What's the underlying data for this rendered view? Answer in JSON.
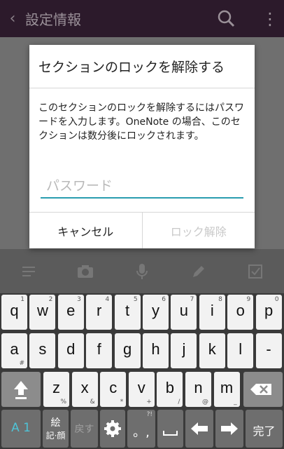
{
  "appbar": {
    "title": "設定情報"
  },
  "dialog": {
    "title": "セクションのロックを解除する",
    "message": "このセクションのロックを解除するにはパスワードを入力します。OneNote の場合、このセクションは数分後にロックされます。",
    "password_placeholder": "パスワード",
    "cancel_label": "キャンセル",
    "unlock_label": "ロック解除"
  },
  "keyboard": {
    "row1": [
      {
        "k": "q",
        "s": "1"
      },
      {
        "k": "w",
        "s": "2"
      },
      {
        "k": "e",
        "s": "3"
      },
      {
        "k": "r",
        "s": "4"
      },
      {
        "k": "t",
        "s": "5"
      },
      {
        "k": "y",
        "s": "6"
      },
      {
        "k": "u",
        "s": "7"
      },
      {
        "k": "i",
        "s": "8"
      },
      {
        "k": "o",
        "s": "9"
      },
      {
        "k": "p",
        "s": "0"
      }
    ],
    "row2": [
      {
        "k": "a",
        "s": "#"
      },
      {
        "k": "s",
        "s": ""
      },
      {
        "k": "d",
        "s": ""
      },
      {
        "k": "f",
        "s": ""
      },
      {
        "k": "g",
        "s": ""
      },
      {
        "k": "h",
        "s": ""
      },
      {
        "k": "j",
        "s": ""
      },
      {
        "k": "k",
        "s": ""
      },
      {
        "k": "l",
        "s": ""
      },
      {
        "k": "-",
        "s": ""
      }
    ],
    "row3": [
      {
        "k": "z",
        "s": "%"
      },
      {
        "k": "x",
        "s": "&"
      },
      {
        "k": "c",
        "s": "*"
      },
      {
        "k": "v",
        "s": "+"
      },
      {
        "k": "b",
        "s": "/"
      },
      {
        "k": "n",
        "s": "@"
      },
      {
        "k": "m",
        "s": "_"
      }
    ],
    "mode_label": "A 1",
    "emoji_label_line1": "絵",
    "emoji_label_line2": "記·顔",
    "undo_label": "戻す",
    "punct_label": "?!",
    "punct_main": "。,",
    "done_label": "完了"
  }
}
